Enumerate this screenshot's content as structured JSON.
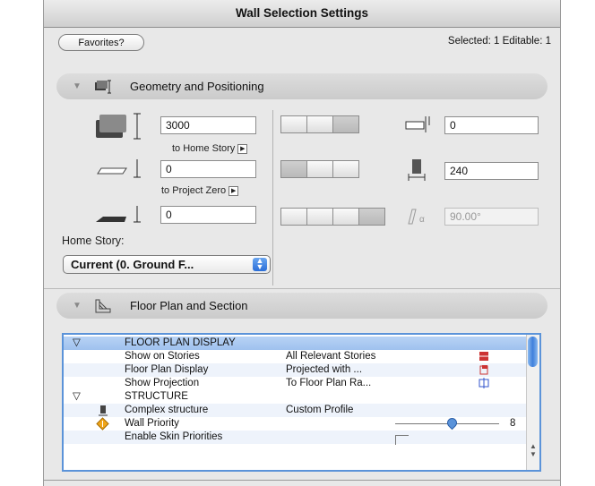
{
  "window": {
    "title": "Wall Selection Settings"
  },
  "header": {
    "favorites_label": "Favorites?",
    "selection_info": "Selected: 1 Editable: 1"
  },
  "sections": {
    "geometry": {
      "label": "Geometry and Positioning",
      "icon": "wall-geometry-icon"
    },
    "floorplan": {
      "label": "Floor Plan and Section",
      "icon": "floor-plan-icon"
    }
  },
  "geometry": {
    "height_value": "3000",
    "to_home_story_label": "to Home Story",
    "bottom_offset_value": "0",
    "to_project_zero_label": "to Project Zero",
    "base_value": "0",
    "home_story_label": "Home Story:",
    "home_story_selected": "Current (0. Ground F...",
    "offset_value": "0",
    "thickness_value": "240",
    "slant_angle_value": "90.00°"
  },
  "table": {
    "rows": [
      {
        "type": "group",
        "expand": "▽",
        "name": "FLOOR PLAN DISPLAY",
        "value": ""
      },
      {
        "type": "item",
        "name": "Show on Stories",
        "value": "All Relevant Stories",
        "icon": "stories-icon"
      },
      {
        "type": "item",
        "name": "Floor Plan Display",
        "value": "Projected with ...",
        "icon": "projection-icon"
      },
      {
        "type": "item",
        "name": "Show Projection",
        "value": "To Floor Plan Ra...",
        "icon": "range-icon"
      },
      {
        "type": "group",
        "expand": "▽",
        "name": "STRUCTURE",
        "value": ""
      },
      {
        "type": "item",
        "name": "Complex structure",
        "value": "Custom Profile",
        "icon": "profile-icon"
      },
      {
        "type": "item",
        "name": "Wall Priority",
        "value": "8",
        "icon": "priority-icon",
        "slider_fraction": 0.52
      },
      {
        "type": "item",
        "name": "Enable Skin Priorities",
        "value": "",
        "icon": "checkbox-icon"
      }
    ]
  },
  "colors": {
    "selection_blue": "#9fc1ee",
    "accent": "#3f7fdb"
  }
}
